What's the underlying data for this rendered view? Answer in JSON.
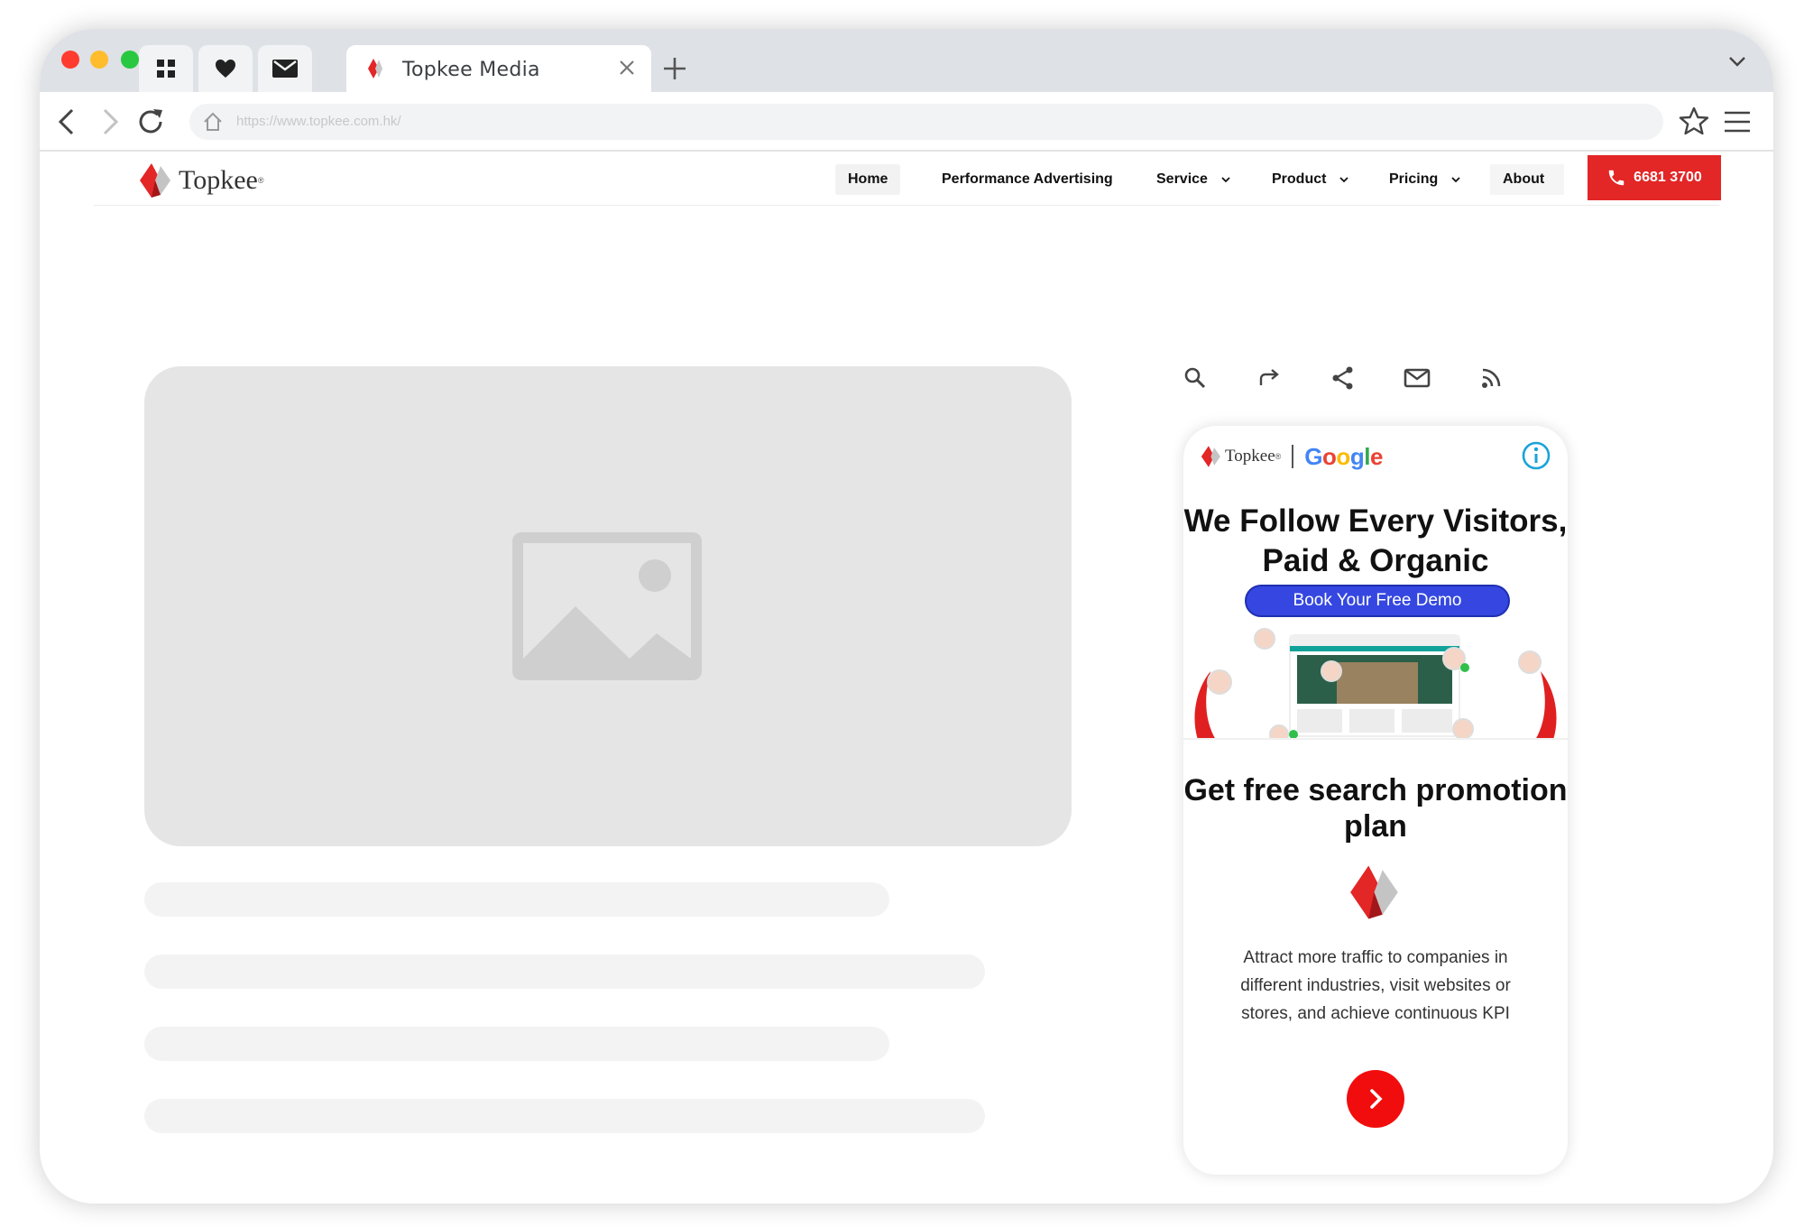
{
  "browser": {
    "tab_title": "Topkee Media",
    "url": "https://www.topkee.com.hk/"
  },
  "site": {
    "logo_text": "Topkee",
    "logo_reg": "®",
    "nav": {
      "home": "Home",
      "performance": "Performance Advertising",
      "service": "Service",
      "product": "Product",
      "pricing": "Pricing",
      "about": "About"
    },
    "phone": "6681 3700"
  },
  "ad": {
    "brand_topkee": "Topkee",
    "brand_reg": "®",
    "headline": "We Follow Every Visitors, Paid & Organic",
    "demo_button": "Book Your Free Demo",
    "title": "Get free search promotion plan",
    "description": "Attract more traffic to companies in different industries, visit websites or stores, and achieve continuous KPI"
  },
  "colors": {
    "accent_red": "#e32626",
    "demo_blue": "#3547e0",
    "google_blue": "#4285f4",
    "google_red": "#ea4335",
    "google_yellow": "#fbbc05",
    "google_green": "#34a853"
  },
  "icons": [
    "apps-icon",
    "heart-icon",
    "mail-icon",
    "close-icon",
    "plus-icon",
    "chevron-down-icon",
    "back-icon",
    "forward-icon",
    "reload-icon",
    "home-icon",
    "star-icon",
    "menu-icon",
    "phone-icon",
    "image-icon",
    "search-icon",
    "forward-share-icon",
    "share-icon",
    "mail-icon",
    "rss-icon",
    "info-icon",
    "arrow-right-icon"
  ]
}
